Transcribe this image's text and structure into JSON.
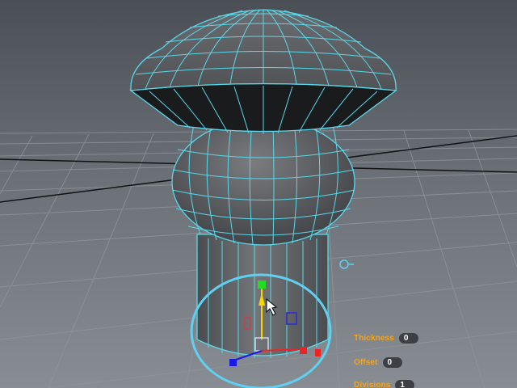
{
  "viewport": {
    "background": "#6d7279",
    "grid_color": "#93989e",
    "axis_color": "#111111",
    "wireframe_color": "#59d8ea",
    "mesh_color": "#5c5e62"
  },
  "manipulator": {
    "icons": [
      "move-y-handle-icon",
      "move-x-handle-icon",
      "move-z-handle-icon",
      "rotate-ring-icon",
      "pivot-icon"
    ],
    "colors": {
      "x": "#ee2222",
      "y": "#22dd22",
      "z": "#1a1ae6",
      "center": "#f5d800",
      "ring": "#5fd0f0"
    }
  },
  "hud": {
    "thickness": {
      "label": "Thickness",
      "value": "0"
    },
    "offset": {
      "label": "Offset",
      "value": "0"
    },
    "divisions": {
      "label": "Divisions",
      "value": "1"
    }
  }
}
